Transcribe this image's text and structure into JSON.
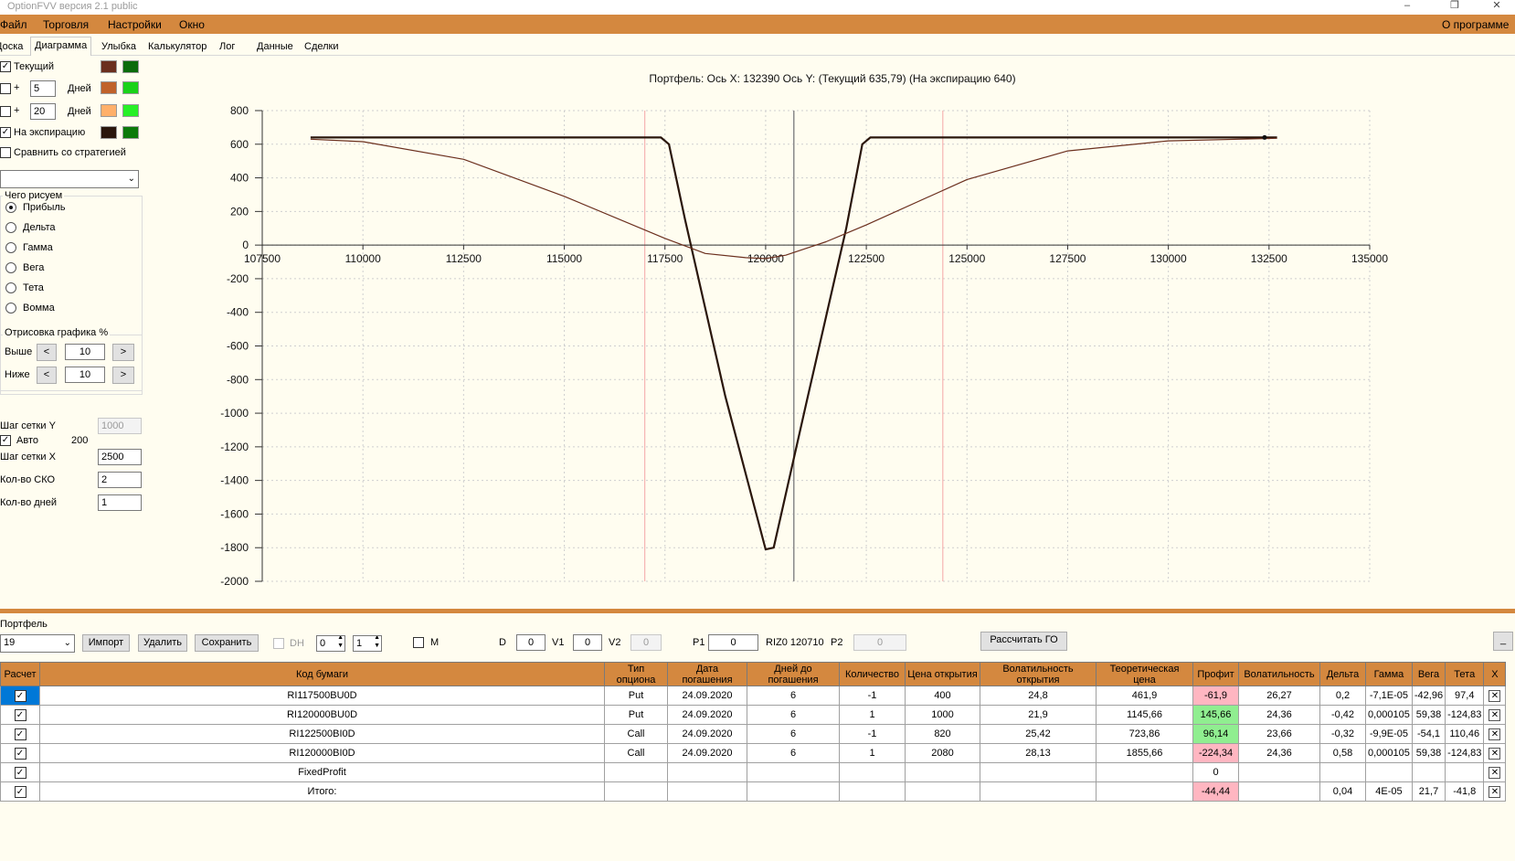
{
  "window": {
    "title": "OptionFVV версия 2.1 public",
    "min": "–",
    "max": "❐",
    "close": "✕"
  },
  "menu": {
    "items": [
      "Файл",
      "Торговля",
      "Настройки",
      "Окно"
    ],
    "about": "О программе"
  },
  "tabs": [
    "Доска",
    "Диаграмма",
    "Улыбка",
    "Калькулятор",
    "Лог",
    "Данные",
    "Сделки"
  ],
  "left": {
    "current": {
      "label": "Текущий",
      "checked": true,
      "colors": [
        "#6b2f1e",
        "#0b6b0b"
      ]
    },
    "days1": {
      "prefix": "+",
      "value": "5",
      "unit": "Дней",
      "checked": false,
      "colors": [
        "#c0622a",
        "#1ad21a"
      ]
    },
    "days2": {
      "prefix": "+",
      "value": "20",
      "unit": "Дней",
      "checked": false,
      "colors": [
        "#ffb06a",
        "#27f027"
      ]
    },
    "expiration": {
      "label": "На экспирацию",
      "checked": true,
      "colors": [
        "#2a160c",
        "#0b7a0b"
      ]
    },
    "compare": {
      "label": "Сравнить со стратегией",
      "checked": false
    },
    "compare_select": "",
    "draw_group": {
      "title": "Чего рисуем",
      "options": [
        "Прибыль",
        "Дельта",
        "Гамма",
        "Вега",
        "Тета",
        "Вомма"
      ],
      "selected": 0
    },
    "render_group": {
      "title": "Отрисовка графика %",
      "above_label": "Выше",
      "above_value": "10",
      "below_label": "Ниже",
      "below_value": "10",
      "left_arrow": "<",
      "right_arrow": ">"
    },
    "grid_y_label": "Шаг сетки Y",
    "grid_y_value": "1000",
    "auto_label": "Авто",
    "auto_value": "200",
    "auto_checked": true,
    "grid_x_label": "Шаг сетки X",
    "grid_x_value": "2500",
    "sko_label": "Кол-во СКО",
    "sko_value": "2",
    "days_label": "Кол-во дней",
    "days_value": "1"
  },
  "chart_data": {
    "type": "line",
    "title": "Портфель:  Ось X:  132390  Ось Y:   (Текущий 635,79)  (На экспирацию 640)",
    "x_ticks": [
      107500,
      110000,
      112500,
      115000,
      117500,
      120000,
      122500,
      125000,
      127500,
      130000,
      132500,
      135000
    ],
    "y_ticks": [
      800,
      600,
      400,
      200,
      0,
      -200,
      -400,
      -600,
      -800,
      -1000,
      -1200,
      -1400,
      -1600,
      -1800,
      -2000
    ],
    "xlim": [
      107500,
      135000
    ],
    "ylim": [
      -2000,
      800
    ],
    "cursor_x": 120700,
    "sigma_lines": [
      117000,
      124400
    ],
    "marker": {
      "x": 132390,
      "y": 640
    },
    "series": [
      {
        "color": "#2a160c",
        "x": [
          108700,
          117400,
          117600,
          118000,
          119000,
          120000,
          120200,
          121000,
          122000,
          122400,
          122600,
          132700
        ],
        "y": [
          640,
          640,
          600,
          150,
          -900,
          -1810,
          -1800,
          -950,
          100,
          600,
          640,
          640
        ]
      },
      {
        "color": "#6b2f1e",
        "x": [
          108700,
          110000,
          112500,
          115000,
          117500,
          118500,
          119500,
          120000,
          120500,
          121500,
          122500,
          125000,
          127500,
          130000,
          132700
        ],
        "y": [
          630,
          615,
          510,
          290,
          40,
          -50,
          -75,
          -80,
          -60,
          20,
          120,
          390,
          560,
          620,
          635
        ]
      }
    ]
  },
  "portfolio": {
    "label": "Портфель",
    "select_value": "19",
    "import": "Импорт",
    "delete": "Удалить",
    "save": "Сохранить",
    "dh_label": "DH",
    "dh_checked": false,
    "spin1": "0",
    "spin2": "1",
    "m_label": "M",
    "m_checked": false,
    "d_label": "D",
    "d_value": "0",
    "v1_label": "V1",
    "v1_value": "0",
    "v2_label": "V2",
    "v2_value": "0",
    "p1_label": "P1",
    "p1_value": "0",
    "riz_text": "RIZ0 120710",
    "p2_label": "P2",
    "p2_value": "0",
    "calc_go": "Рассчитать ГО",
    "minimize": "_"
  },
  "table": {
    "headers": [
      "Расчет",
      "Код бумаги",
      "Тип опциона",
      "Дата погашения",
      "Дней до погашения",
      "Количество",
      "Цена открытия",
      "Волатильность открытия",
      "Теоретическая цена",
      "Профит",
      "Волатильность",
      "Дельта",
      "Гамма",
      "Вега",
      "Тета",
      "X"
    ],
    "rows": [
      {
        "code": "RI117500BU0D",
        "type": "Put",
        "date": "24.09.2020",
        "days": "6",
        "qty": "-1",
        "price": "400",
        "vol_open": "24,8",
        "theor": "461,9",
        "profit": "-61,9",
        "profit_sign": "neg",
        "vol": "26,27",
        "delta": "0,2",
        "gamma": "-7,1E-05",
        "vega": "-42,96",
        "theta": "97,4",
        "x": "✕",
        "selected": true
      },
      {
        "code": "RI120000BU0D",
        "type": "Put",
        "date": "24.09.2020",
        "days": "6",
        "qty": "1",
        "price": "1000",
        "vol_open": "21,9",
        "theor": "1145,66",
        "profit": "145,66",
        "profit_sign": "pos",
        "vol": "24,36",
        "delta": "-0,42",
        "gamma": "0,000105",
        "vega": "59,38",
        "theta": "-124,83",
        "x": "✕",
        "selected": false
      },
      {
        "code": "RI122500BI0D",
        "type": "Call",
        "date": "24.09.2020",
        "days": "6",
        "qty": "-1",
        "price": "820",
        "vol_open": "25,42",
        "theor": "723,86",
        "profit": "96,14",
        "profit_sign": "pos",
        "vol": "23,66",
        "delta": "-0,32",
        "gamma": "-9,9E-05",
        "vega": "-54,1",
        "theta": "110,46",
        "x": "✕",
        "selected": false
      },
      {
        "code": "RI120000BI0D",
        "type": "Call",
        "date": "24.09.2020",
        "days": "6",
        "qty": "1",
        "price": "2080",
        "vol_open": "28,13",
        "theor": "1855,66",
        "profit": "-224,34",
        "profit_sign": "neg",
        "vol": "24,36",
        "delta": "0,58",
        "gamma": "0,000105",
        "vega": "59,38",
        "theta": "-124,83",
        "x": "✕",
        "selected": false
      },
      {
        "code": "FixedProfit",
        "type": "",
        "date": "",
        "days": "",
        "qty": "",
        "price": "",
        "vol_open": "",
        "theor": "",
        "profit": "0",
        "profit_sign": "",
        "vol": "",
        "delta": "",
        "gamma": "",
        "vega": "",
        "theta": "",
        "x": "✕",
        "selected": false
      },
      {
        "code": "Итого:",
        "type": "",
        "date": "",
        "days": "",
        "qty": "",
        "price": "",
        "vol_open": "",
        "theor": "",
        "profit": "-44,44",
        "profit_sign": "neg",
        "vol": "",
        "delta": "0,04",
        "gamma": "4E-05",
        "vega": "21,7",
        "theta": "-41,8",
        "x": "✕",
        "selected": false
      }
    ]
  }
}
